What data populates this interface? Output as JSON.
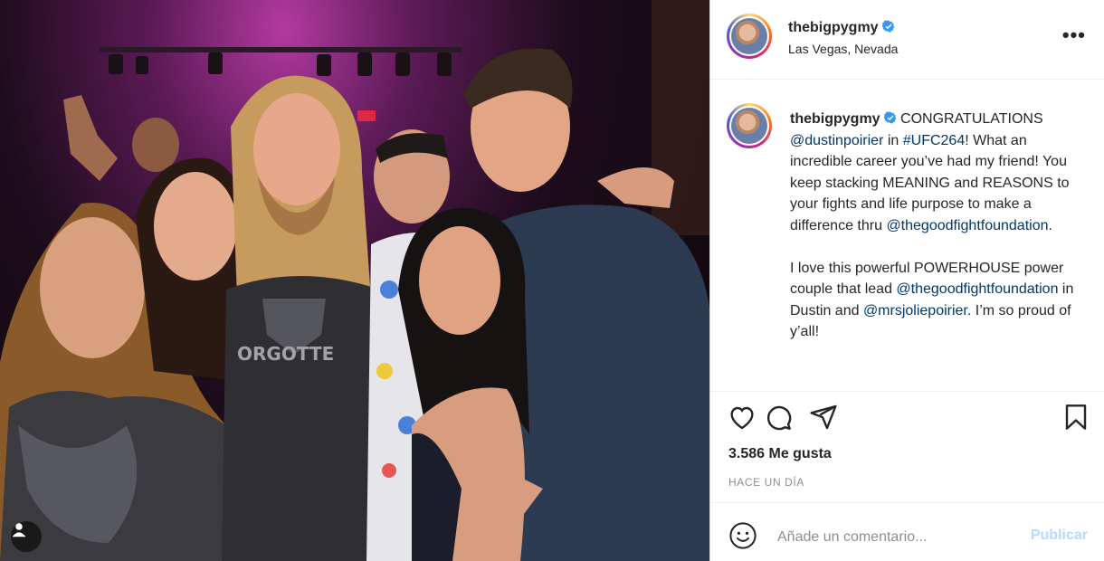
{
  "post": {
    "photo_alt": "",
    "user": {
      "username": "thebigpygmy",
      "verified": true,
      "location": "Las Vegas, Nevada"
    },
    "more_label": "•••",
    "caption": {
      "username": "thebigpygmy",
      "parts": [
        {
          "t": "text",
          "v": " CONGRATULATIONS\n"
        },
        {
          "t": "mention",
          "v": "@dustinpoirier"
        },
        {
          "t": "text",
          "v": " in "
        },
        {
          "t": "mention",
          "v": "#UFC264"
        },
        {
          "t": "text",
          "v": "! What an incredible career you’ve had my friend! You keep stacking MEANING and REASONS to your fights and life purpose to make a difference thru "
        },
        {
          "t": "mention",
          "v": "@thegoodfightfoundation"
        },
        {
          "t": "text",
          "v": ".\n\nI love this powerful POWERHOUSE power couple that lead "
        },
        {
          "t": "mention",
          "v": "@thegoodfightfoundation"
        },
        {
          "t": "text",
          "v": " in Dustin and "
        },
        {
          "t": "mention",
          "v": "@mrsjoliepoirier"
        },
        {
          "t": "text",
          "v": ". I’m so proud of y’all!"
        }
      ]
    },
    "actions": {
      "like_icon": "heart-icon",
      "comment_icon": "comment-icon",
      "share_icon": "paper-plane-icon",
      "save_icon": "bookmark-icon"
    },
    "likes_text": "3.586 Me gusta",
    "time_ago": "HACE UN DÍA",
    "comment": {
      "placeholder": "Añade un comentario...",
      "publish_label": "Publicar"
    }
  },
  "colors": {
    "verified": "#3897f0",
    "mention": "#00376b",
    "publish_disabled": "#b3dbff"
  }
}
